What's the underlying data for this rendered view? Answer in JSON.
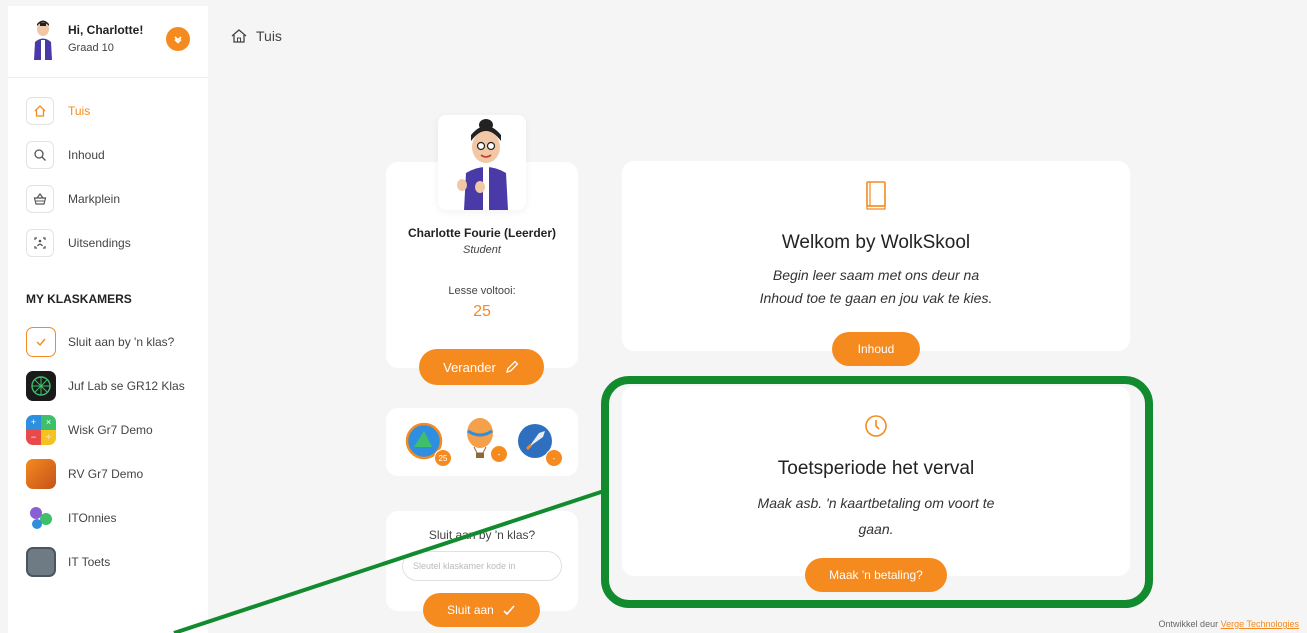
{
  "user": {
    "greeting": "Hi, Charlotte!",
    "grade": "Graad 10"
  },
  "nav": {
    "home": "Tuis",
    "content": "Inhoud",
    "market": "Markplein",
    "broadcasts": "Uitsendings"
  },
  "classrooms": {
    "title": "MY KLASKAMERS",
    "items": [
      {
        "label": "Sluit aan by 'n klas?"
      },
      {
        "label": "Juf Lab se GR12 Klas"
      },
      {
        "label": "Wisk Gr7 Demo"
      },
      {
        "label": "RV Gr7 Demo"
      },
      {
        "label": "ITOnnies"
      },
      {
        "label": "IT Toets"
      }
    ]
  },
  "breadcrumb": {
    "label": "Tuis"
  },
  "profile": {
    "name": "Charlotte Fourie (Leerder)",
    "role": "Student",
    "lessons_label": "Lesse voltooi:",
    "lessons_value": "25",
    "change_button": "Verander"
  },
  "badges": [
    {
      "count": "25"
    },
    {
      "count": "-"
    },
    {
      "count": "-"
    }
  ],
  "join": {
    "title": "Sluit aan by 'n klas?",
    "placeholder": "Sleutel klaskamer kode in",
    "button": "Sluit aan"
  },
  "welcome": {
    "title": "Welkom by WolkSkool",
    "line1": "Begin leer saam met ons deur na",
    "line2": "Inhoud toe te gaan en jou vak te kies.",
    "button": "Inhoud"
  },
  "period": {
    "title": "Toetsperiode het verval",
    "line1": "Maak asb. 'n kaartbetaling om voort te",
    "line2": "gaan.",
    "button": "Maak 'n betaling?"
  },
  "footer": {
    "prefix": "Ontwikkel deur",
    "link": "Verge Technologies"
  },
  "colors": {
    "accent": "#f58a1f",
    "highlight": "#128a2e"
  }
}
